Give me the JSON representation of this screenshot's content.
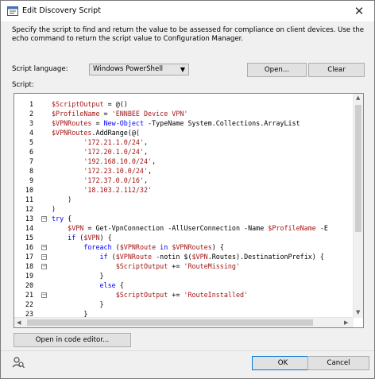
{
  "window": {
    "title": "Edit Discovery Script",
    "close_glyph": "✕"
  },
  "description": "Specify the script to find and return the value to be assessed for compliance on client devices. Use the echo command to return the script value to Configuration Manager.",
  "script_language": {
    "label": "Script language:",
    "selected": "Windows PowerShell"
  },
  "buttons": {
    "open": "Open...",
    "clear": "Clear",
    "open_in_editor": "Open in code editor...",
    "ok": "OK",
    "cancel": "Cancel"
  },
  "script_label": "Script:",
  "editor": {
    "line_numbers": [
      "1",
      "2",
      "3",
      "4",
      "5",
      "6",
      "7",
      "8",
      "9",
      "10",
      "11",
      "12",
      "13",
      "14",
      "15",
      "16",
      "17",
      "18",
      "19",
      "20",
      "21",
      "22",
      "23"
    ],
    "fold_markers": [
      {
        "line": "13",
        "glyph": "−"
      },
      {
        "line": "16",
        "glyph": "−"
      },
      {
        "line": "17",
        "glyph": "−"
      },
      {
        "line": "18",
        "glyph": "−"
      },
      {
        "line": "21",
        "glyph": "−"
      }
    ],
    "lines": [
      "$ScriptOutput = @()",
      "$ProfileName = 'ENNBEE Device VPN'",
      "$VPNRoutes = New-Object -TypeName System.Collections.ArrayList",
      "$VPNRoutes.AddRange(@(",
      "        '172.21.1.0/24',",
      "        '172.20.1.0/24',",
      "        '192.168.10.0/24',",
      "        '172.23.10.0/24',",
      "        '172.37.0.0/16',",
      "        '18.103.2.112/32'",
      "    )",
      ")",
      "try {",
      "    $VPN = Get-VpnConnection -AllUserConnection -Name $ProfileName -E",
      "    if ($VPN) {",
      "        foreach ($VPNRoute in $VPNRoutes) {",
      "            if ($VPNRoute -notin $($VPN.Routes).DestinationPrefix) {",
      "                $ScriptOutput += 'RouteMissing'",
      "            }",
      "            else {",
      "                $ScriptOutput += 'RouteInstalled'",
      "            }",
      "        }"
    ]
  },
  "icons": {
    "title": "script-icon",
    "status": "user-search-icon"
  },
  "colors": {
    "variable": "#a31515",
    "string": "#a31515",
    "keyword": "#0000ff",
    "background": "#f0f0f0"
  }
}
